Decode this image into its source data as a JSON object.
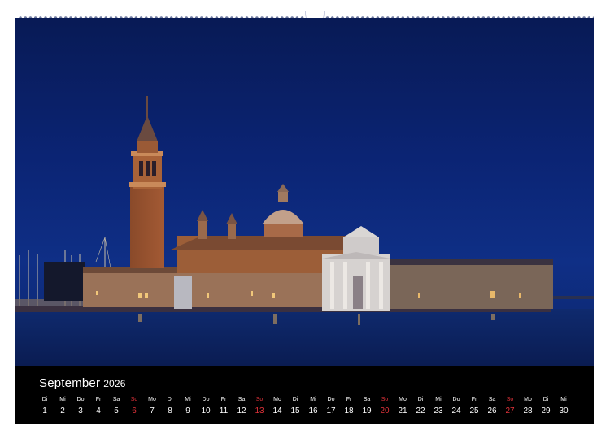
{
  "calendar": {
    "month": "September",
    "year": "2026",
    "days": [
      {
        "name": "Di",
        "num": "1",
        "sunday": false
      },
      {
        "name": "Mi",
        "num": "2",
        "sunday": false
      },
      {
        "name": "Do",
        "num": "3",
        "sunday": false
      },
      {
        "name": "Fr",
        "num": "4",
        "sunday": false
      },
      {
        "name": "Sa",
        "num": "5",
        "sunday": false
      },
      {
        "name": "So",
        "num": "6",
        "sunday": true
      },
      {
        "name": "Mo",
        "num": "7",
        "sunday": false
      },
      {
        "name": "Di",
        "num": "8",
        "sunday": false
      },
      {
        "name": "Mi",
        "num": "9",
        "sunday": false
      },
      {
        "name": "Do",
        "num": "10",
        "sunday": false
      },
      {
        "name": "Fr",
        "num": "11",
        "sunday": false
      },
      {
        "name": "Sa",
        "num": "12",
        "sunday": false
      },
      {
        "name": "So",
        "num": "13",
        "sunday": true
      },
      {
        "name": "Mo",
        "num": "14",
        "sunday": false
      },
      {
        "name": "Di",
        "num": "15",
        "sunday": false
      },
      {
        "name": "Mi",
        "num": "16",
        "sunday": false
      },
      {
        "name": "Do",
        "num": "17",
        "sunday": false
      },
      {
        "name": "Fr",
        "num": "18",
        "sunday": false
      },
      {
        "name": "Sa",
        "num": "19",
        "sunday": false
      },
      {
        "name": "So",
        "num": "20",
        "sunday": true
      },
      {
        "name": "Mo",
        "num": "21",
        "sunday": false
      },
      {
        "name": "Di",
        "num": "22",
        "sunday": false
      },
      {
        "name": "Mi",
        "num": "23",
        "sunday": false
      },
      {
        "name": "Do",
        "num": "24",
        "sunday": false
      },
      {
        "name": "Fr",
        "num": "25",
        "sunday": false
      },
      {
        "name": "Sa",
        "num": "26",
        "sunday": false
      },
      {
        "name": "So",
        "num": "27",
        "sunday": true
      },
      {
        "name": "Mo",
        "num": "28",
        "sunday": false
      },
      {
        "name": "Di",
        "num": "29",
        "sunday": false
      },
      {
        "name": "Mi",
        "num": "30",
        "sunday": false
      }
    ]
  },
  "colors": {
    "sunday": "#e0323a",
    "calendar_bar": "#000000",
    "sky": "#0b2474"
  }
}
